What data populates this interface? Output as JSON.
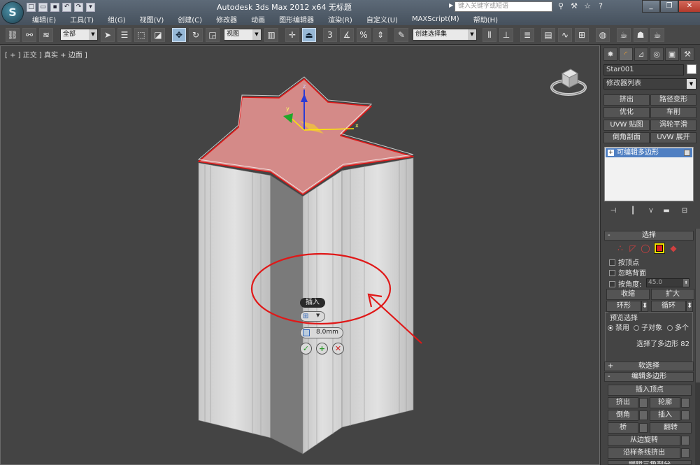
{
  "titlebar": {
    "logo": "S",
    "title": "Autodesk 3ds Max  2012 x64    无标题",
    "search_placeholder": "键入关键字或短语"
  },
  "menu": [
    "编辑(E)",
    "工具(T)",
    "组(G)",
    "视图(V)",
    "创建(C)",
    "修改器",
    "动画",
    "图形编辑器",
    "渲染(R)",
    "自定义(U)",
    "MAXScript(M)",
    "帮助(H)"
  ],
  "toolbar": {
    "selection_filter": "全部",
    "ref_coord": "视图",
    "named_selection": "创建选择集",
    "snap_3": "3",
    "snap_percent": "%"
  },
  "viewport": {
    "label": "[ + ] 正交 ] 真实 + 边面 ]",
    "gizmo_axes": [
      "x",
      "y",
      "z"
    ]
  },
  "caddy": {
    "title": "插入",
    "value": "8.0mm"
  },
  "command_panel": {
    "object_name": "Star001",
    "modifier_list": "修改器列表",
    "modifier_buttons": [
      "挤出",
      "路径变形",
      "优化",
      "车削",
      "UVW 贴图",
      "涡轮平滑",
      "倒角剖面",
      "UVW 展开"
    ],
    "stack_item": "可编辑多边形",
    "selection": {
      "header": "选择",
      "by_vertex": "按顶点",
      "ignore_backfacing": "忽略背面",
      "by_angle": "按角度:",
      "angle_value": "45.0",
      "shrink": "收缩",
      "grow": "扩大",
      "ring": "环形",
      "loop": "循环",
      "preview_title": "预览选择",
      "preview_options": [
        "禁用",
        "子对象",
        "多个"
      ],
      "status": "选择了多边形 82"
    },
    "soft_selection_header": "软选择",
    "edit_poly": {
      "header": "编辑多边形",
      "insert_vertex": "插入顶点",
      "extrude": "挤出",
      "outline": "轮廓",
      "bevel": "倒角",
      "inset": "插入",
      "bridge": "桥",
      "flip": "翻转",
      "hinge": "从边旋转",
      "extrude_spline": "沿样条线挤出",
      "edit_tri": "编辑三角剖分"
    }
  },
  "colors": {
    "selection_fill": "#d48a88",
    "annotation_red": "#e01818",
    "stack_highlight": "#4f7fc2",
    "active_subobj": "#f0e000"
  }
}
